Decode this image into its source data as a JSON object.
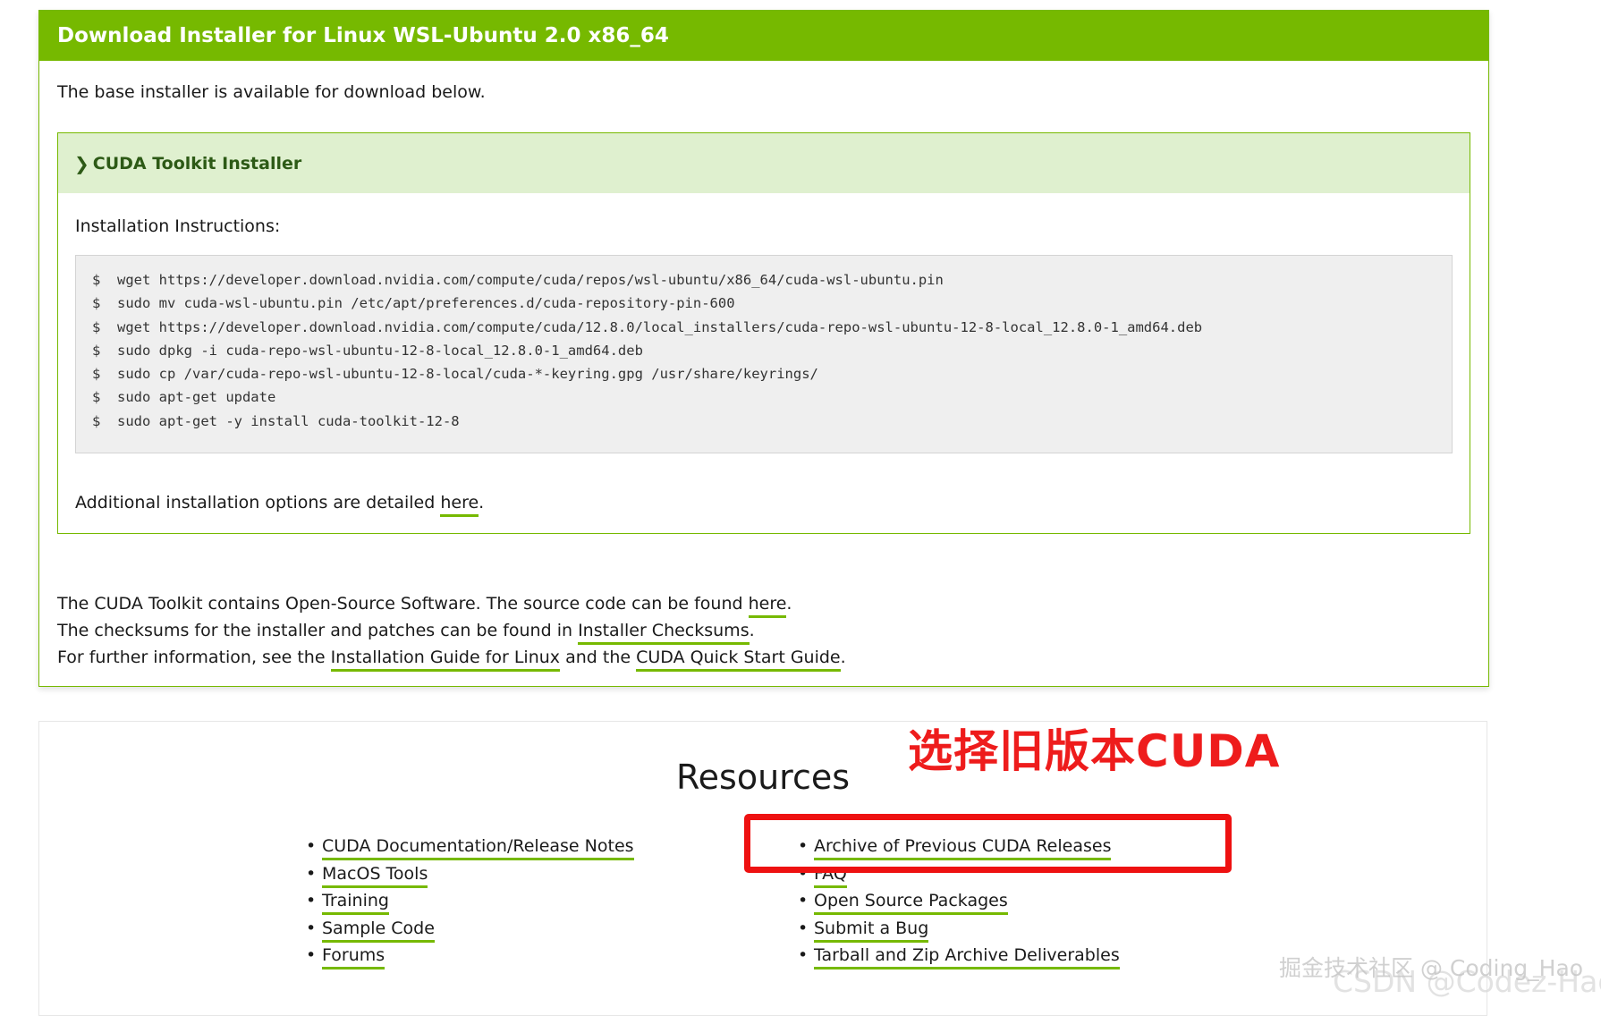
{
  "panel": {
    "header": "Download Installer for Linux WSL-Ubuntu 2.0 x86_64",
    "intro": "The base installer is available for download below.",
    "installer": {
      "title": "CUDA Toolkit Installer",
      "instructions_label": "Installation Instructions:",
      "prompt": "$",
      "commands": [
        "wget https://developer.download.nvidia.com/compute/cuda/repos/wsl-ubuntu/x86_64/cuda-wsl-ubuntu.pin",
        "sudo mv cuda-wsl-ubuntu.pin /etc/apt/preferences.d/cuda-repository-pin-600",
        "wget https://developer.download.nvidia.com/compute/cuda/12.8.0/local_installers/cuda-repo-wsl-ubuntu-12-8-local_12.8.0-1_amd64.deb",
        "sudo dpkg -i cuda-repo-wsl-ubuntu-12-8-local_12.8.0-1_amd64.deb",
        "sudo cp /var/cuda-repo-wsl-ubuntu-12-8-local/cuda-*-keyring.gpg /usr/share/keyrings/",
        "sudo apt-get update",
        "sudo apt-get -y install cuda-toolkit-12-8"
      ],
      "additional_prefix": "Additional installation options are detailed ",
      "additional_link": "here",
      "additional_suffix": "."
    },
    "footer": {
      "line1_prefix": "The CUDA Toolkit contains Open-Source Software. The source code can be found ",
      "line1_link": "here",
      "line1_suffix": ".",
      "line2_prefix": "The checksums for the installer and patches can be found in ",
      "line2_link": "Installer Checksums",
      "line2_suffix": ".",
      "line3_prefix": "For further information, see the ",
      "line3_link1": "Installation Guide for Linux",
      "line3_mid": " and the ",
      "line3_link2": "CUDA Quick Start Guide",
      "line3_suffix": "."
    }
  },
  "resources": {
    "title": "Resources",
    "left": [
      "CUDA Documentation/Release Notes",
      "MacOS Tools",
      "Training",
      "Sample Code",
      "Forums"
    ],
    "right": [
      "Archive of Previous CUDA Releases",
      "FAQ",
      "Open Source Packages",
      "Submit a Bug",
      "Tarball and Zip Archive Deliverables"
    ]
  },
  "annotation": {
    "text": "选择旧版本CUDA",
    "color": "#ee1c1c"
  },
  "watermarks": {
    "line1": "掘金技术社区 @ Coding_Hao",
    "line2": "CSDN @Codez-Hao"
  },
  "colors": {
    "accent": "#76b900",
    "header_bg": "#76b900",
    "installer_head_bg": "#dff0cf",
    "code_bg": "#efefef"
  },
  "icons": {
    "installer_toggle": "chevron-right-icon",
    "list_bullet": "bullet-icon"
  }
}
